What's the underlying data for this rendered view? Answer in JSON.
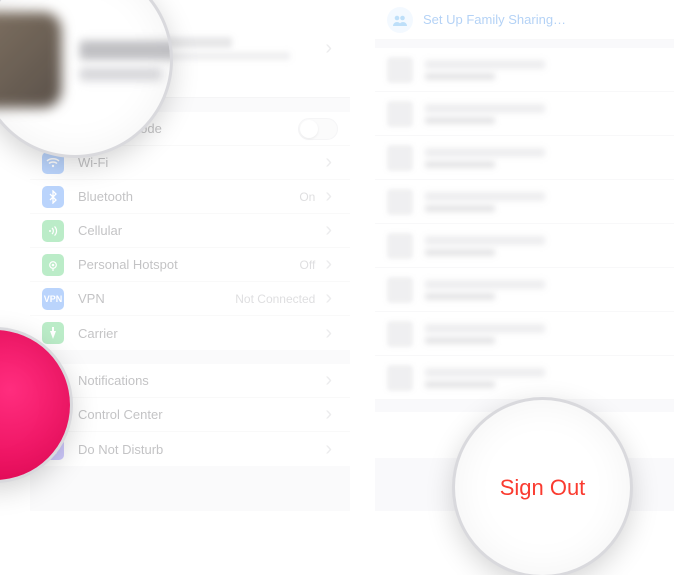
{
  "left": {
    "rows": [
      {
        "icon": "airplane",
        "cls": "ic-airplane",
        "label": "Airplane Mode",
        "value": "",
        "toggle": true
      },
      {
        "icon": "wifi",
        "cls": "ic-wifi",
        "label": "Wi-Fi",
        "value": ""
      },
      {
        "icon": "bt",
        "cls": "ic-bt",
        "label": "Bluetooth",
        "value": "On"
      },
      {
        "icon": "cell",
        "cls": "ic-cell",
        "label": "Cellular",
        "value": ""
      },
      {
        "icon": "hotspot",
        "cls": "ic-hotspot",
        "label": "Personal Hotspot",
        "value": "Off"
      },
      {
        "icon": "vpn",
        "cls": "ic-vpn",
        "label": "VPN",
        "value": "Not Connected"
      },
      {
        "icon": "carrier",
        "cls": "ic-carrier",
        "label": "Carrier",
        "value": ""
      }
    ],
    "rows2": [
      {
        "icon": "notif",
        "cls": "ic-notif",
        "label": "Notifications"
      },
      {
        "icon": "cc",
        "cls": "ic-cc",
        "label": "Control Center"
      },
      {
        "icon": "dnd",
        "cls": "ic-dnd",
        "label": "Do Not Disturb"
      }
    ]
  },
  "right": {
    "family_label": "Set Up Family Sharing…",
    "device_count": 8,
    "sign_out_label": "Sign Out"
  },
  "lens": {
    "sign_out_label": "Sign Out"
  }
}
